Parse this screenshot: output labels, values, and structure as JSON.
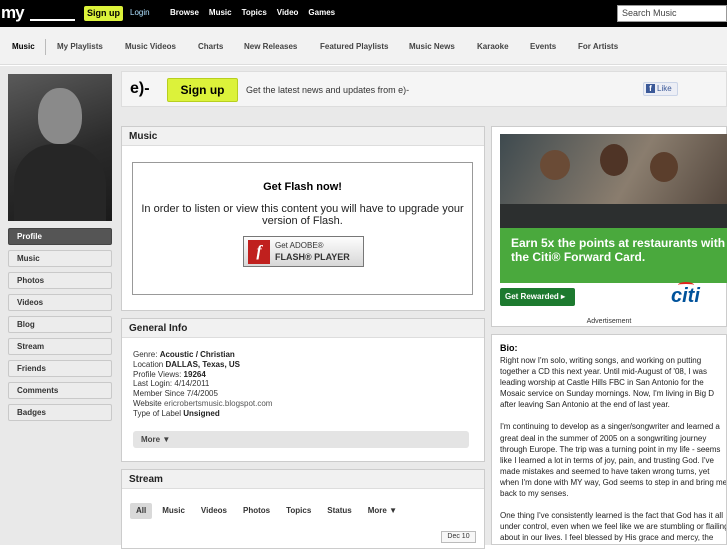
{
  "topbar": {
    "logo": "my",
    "signup": "Sign up",
    "login": "Login",
    "nav": [
      "Browse",
      "Music",
      "Topics",
      "Video",
      "Games"
    ],
    "search_placeholder": "Search Music"
  },
  "subnav": {
    "items": [
      "Music",
      "My Playlists",
      "Music Videos",
      "Charts",
      "New Releases",
      "Featured Playlists",
      "Music News",
      "Karaoke",
      "Events",
      "For Artists"
    ]
  },
  "sidebar": {
    "items": [
      "Profile",
      "Music",
      "Photos",
      "Videos",
      "Blog",
      "Stream",
      "Friends",
      "Comments",
      "Badges"
    ]
  },
  "header": {
    "name": "e)-",
    "signup": "Sign up",
    "text": "Get the latest news and updates from e)-",
    "like_icon": "f",
    "like": "Like"
  },
  "music": {
    "title": "Music",
    "flash_title": "Get Flash now!",
    "flash_text": "In order to listen or view this content you will have to upgrade your version of Flash.",
    "badge_icon": "f",
    "badge_line1": "Get ADOBE®",
    "badge_line2": "FLASH® PLAYER"
  },
  "info": {
    "title": "General Info",
    "lines": [
      {
        "label": "Genre: ",
        "value": "Acoustic / Christian"
      },
      {
        "label": "Location ",
        "value": "DALLAS, Texas, US"
      },
      {
        "label": "Profile Views: ",
        "value": "19264"
      },
      {
        "label": "Last Login: ",
        "value": "4/14/2011"
      },
      {
        "label": "Member Since ",
        "value": "7/4/2005"
      },
      {
        "label": "Website ",
        "value": "ericrobertsmusic.blogspot.com"
      },
      {
        "label": "Type of Label ",
        "value": "Unsigned"
      }
    ],
    "more": "More ▼"
  },
  "stream": {
    "title": "Stream",
    "tabs": [
      "All",
      "Music",
      "Videos",
      "Photos",
      "Topics",
      "Status",
      "More ▼"
    ],
    "date": "Dec 10"
  },
  "ad": {
    "headline": "Earn 5x the points at restaurants with the Citi® Forward Card.",
    "button": "Get Rewarded ▸",
    "brand": "citi",
    "label": "Advertisement"
  },
  "bio": {
    "title": "Bio:",
    "paragraphs": [
      "Right now I'm solo, writing songs, and working on putting together a CD this next year. Until mid-August of '08, I was leading worship at Castle Hills FBC in San Antonio for the Mosaic service on Sunday mornings. Now, I'm living in Big D after leaving San Antonio at the end of last year.",
      "I'm continuing to develop as a singer/songwriter and learned a great deal in the summer of 2005 on a songwriting journey through Europe. The trip was a turning point in my life - seems like I learned a lot in terms of joy, pain, and trusting God. I've made mistakes and seemed to have taken wrong turns, yet when I'm done with MY way, God seems to step in and bring me back to my senses.",
      "One thing I've consistently learned is the fact that God has it all under control, even when we feel like we are stumbling or flailing about in our lives. I feel blessed by His grace and mercy, the sacrifice of Christ, and to be where I am at this"
    ]
  }
}
